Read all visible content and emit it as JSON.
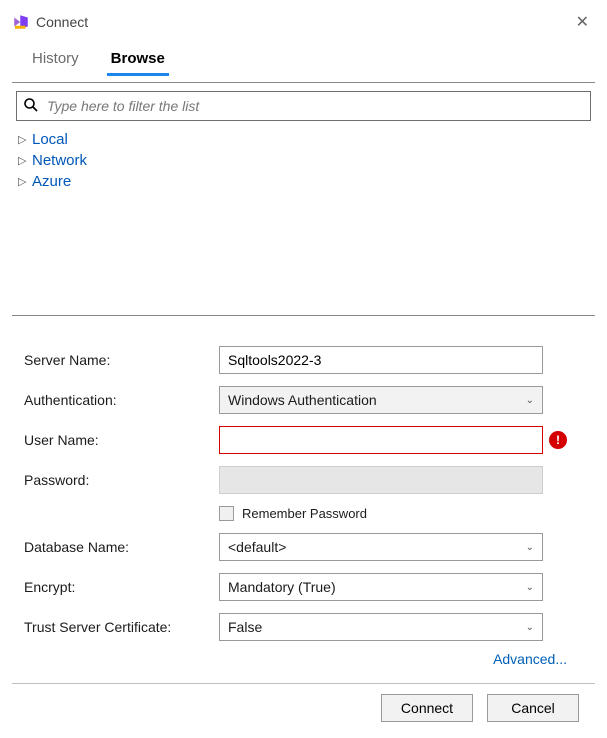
{
  "title": "Connect",
  "tabs": [
    {
      "label": "History",
      "active": false
    },
    {
      "label": "Browse",
      "active": true
    }
  ],
  "search": {
    "placeholder": "Type here to filter the list"
  },
  "tree": [
    "Local",
    "Network",
    "Azure"
  ],
  "form": {
    "server_name": {
      "label": "Server Name:",
      "value": "Sqltools2022-3"
    },
    "authentication": {
      "label": "Authentication:",
      "value": "Windows Authentication"
    },
    "user_name": {
      "label": "User Name:",
      "value": "",
      "error": true
    },
    "password": {
      "label": "Password:",
      "value": "",
      "disabled": true
    },
    "remember_password": {
      "label": "Remember Password",
      "checked": false
    },
    "database_name": {
      "label": "Database Name:",
      "value": "<default>"
    },
    "encrypt": {
      "label": "Encrypt:",
      "value": "Mandatory (True)"
    },
    "trust_cert": {
      "label": "Trust Server Certificate:",
      "value": "False"
    }
  },
  "advanced_link": "Advanced...",
  "buttons": {
    "connect": "Connect",
    "cancel": "Cancel"
  }
}
